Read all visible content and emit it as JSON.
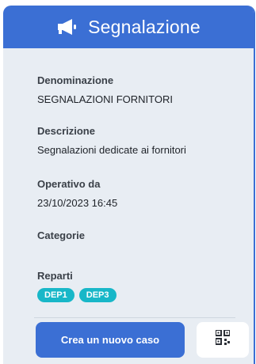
{
  "header": {
    "title": "Segnalazione",
    "icon": "megaphone-icon"
  },
  "fields": {
    "denominazione": {
      "label": "Denominazione",
      "value": "SEGNALAZIONI FORNITORI"
    },
    "descrizione": {
      "label": "Descrizione",
      "value": "Segnalazioni dedicate ai fornitori"
    },
    "operativo": {
      "label": "Operativo da",
      "value": "23/10/2023 16:45"
    },
    "categorie": {
      "label": "Categorie"
    },
    "reparti": {
      "label": "Reparti",
      "chips": [
        "DEP1",
        "DEP3"
      ]
    }
  },
  "actions": {
    "create_label": "Crea un nuovo caso",
    "qr_icon": "qr-code-icon"
  },
  "colors": {
    "primary": "#3b6fd4",
    "chip": "#18b7c8",
    "card_bg": "#e8edf3"
  }
}
